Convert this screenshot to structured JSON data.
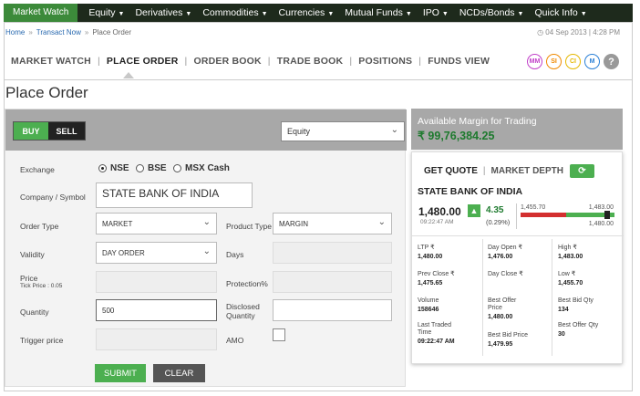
{
  "topnav": {
    "brand": "Market Watch",
    "items": [
      "Equity",
      "Derivatives",
      "Commodities",
      "Currencies",
      "Mutual Funds",
      "IPO",
      "NCDs/Bonds",
      "Quick Info"
    ]
  },
  "breadcrumb": {
    "home": "Home",
    "transact": "Transact Now",
    "current": "Place Order"
  },
  "datetime": "04 Sep 2013 | 4:28 PM",
  "tabs": [
    "MARKET WATCH",
    "PLACE ORDER",
    "ORDER BOOK",
    "TRADE BOOK",
    "POSITIONS",
    "FUNDS VIEW"
  ],
  "badges": [
    {
      "label": "MM",
      "color": "#c13fc9"
    },
    {
      "label": "SI",
      "color": "#f08a00"
    },
    {
      "label": "CI",
      "color": "#e5b800"
    },
    {
      "label": "M",
      "color": "#2a7fd6"
    }
  ],
  "help": "?",
  "page_title": "Place Order",
  "order": {
    "buy_label": "BUY",
    "sell_label": "SELL",
    "segment": "Equity",
    "exchange_label": "Exchange",
    "exchanges": [
      "NSE",
      "BSE",
      "MSX Cash"
    ],
    "company_label": "Company / Symbol",
    "company_value": "STATE BANK OF INDIA",
    "order_type_label": "Order Type",
    "order_type": "MARKET",
    "product_type_label": "Product Type",
    "product_type": "MARGIN",
    "validity_label": "Validity",
    "validity": "DAY ORDER",
    "days_label": "Days",
    "price_label": "Price",
    "tick_price": "Tick Price : 0.05",
    "protection_label": "Protection%",
    "quantity_label": "Quantity",
    "quantity": "500",
    "disclosed_label_1": "Disclosed",
    "disclosed_label_2": "Quantity",
    "trigger_label": "Trigger price",
    "amo_label": "AMO",
    "submit": "SUBMIT",
    "clear": "CLEAR"
  },
  "margin": {
    "title": "Available Margin for Trading",
    "value": "₹ 99,76,384.25"
  },
  "quote": {
    "tab_quote": "GET QUOTE",
    "tab_depth": "MARKET DEPTH",
    "name": "STATE BANK OF INDIA",
    "price": "1,480.00",
    "time": "09:22:47 AM",
    "change": "4.35",
    "change_pct": "(0.29%)",
    "range_low": "1,455.70",
    "range_high": "1,483.00",
    "range_close": "1,480.00",
    "ltp_label": "LTP ₹",
    "ltp": "1,480.00",
    "open_label": "Day Open ₹",
    "open": "1,476.00",
    "high_label": "High ₹",
    "high": "1,483.00",
    "prev_label": "Prev Close ₹",
    "prev": "1,475.65",
    "dclose_label": "Day Close ₹",
    "low_label": "Low ₹",
    "low": "1,455.70",
    "volume_label": "Volume",
    "volume": "158646",
    "bestoffer_label_1": "Best Offer",
    "bestoffer_label_2": "Price",
    "bestoffer": "1,480.00",
    "bestbidqty_label": "Best Bid Qty",
    "bestbidqty": "134",
    "ltt_label_1": "Last Traded",
    "ltt_label_2": "Time",
    "ltt": "09:22:47 AM",
    "bestbid_label": "Best Bid Price",
    "bestbid": "1,479.95",
    "bestofferqty_label": "Best Offer Qty",
    "bestofferqty": "30"
  }
}
